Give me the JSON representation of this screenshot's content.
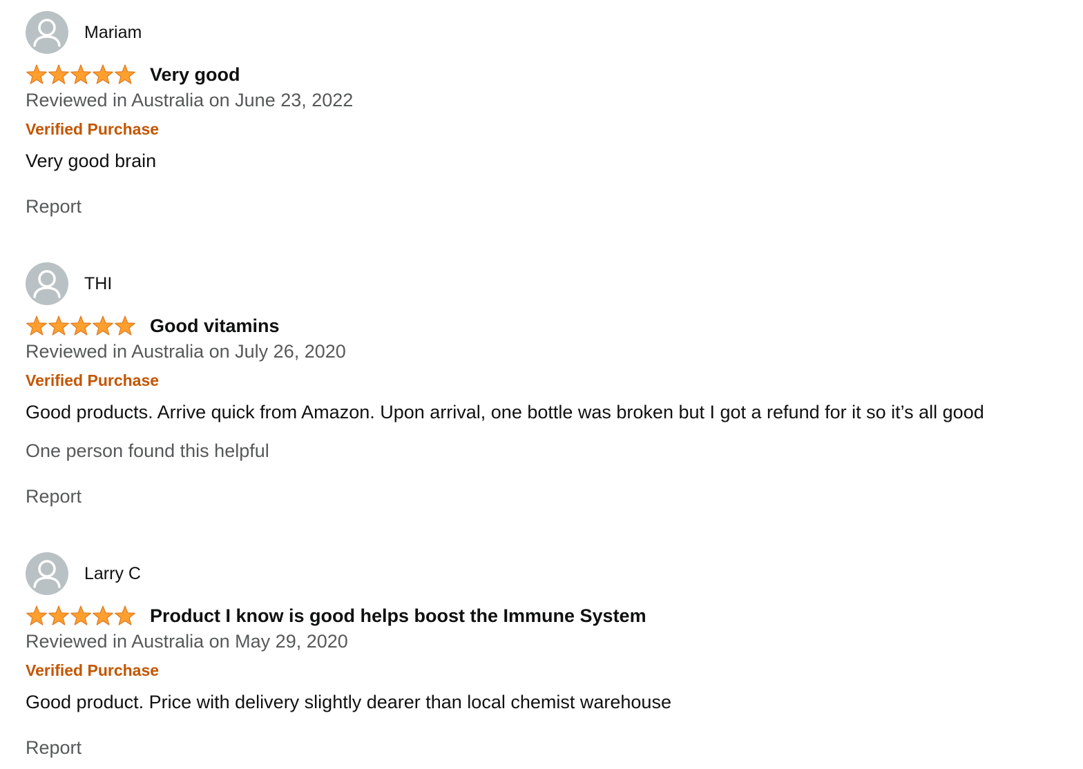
{
  "reviews": [
    {
      "reviewer_name": "Mariam",
      "avatar_icon": "user-avatar-icon",
      "rating": 5,
      "rating_max": 5,
      "title": "Very good",
      "date_line": "Reviewed in Australia on June 23, 2022",
      "verified_label": "Verified Purchase",
      "body": "Very good brain",
      "helpful_text": "",
      "report_label": "Report"
    },
    {
      "reviewer_name": "THI",
      "avatar_icon": "user-avatar-icon",
      "rating": 5,
      "rating_max": 5,
      "title": "Good vitamins",
      "date_line": "Reviewed in Australia on July 26, 2020",
      "verified_label": "Verified Purchase",
      "body": "Good products. Arrive quick from Amazon. Upon arrival, one bottle was broken but I got a refund for it so it’s all good",
      "helpful_text": "One person found this helpful",
      "report_label": "Report"
    },
    {
      "reviewer_name": "Larry C",
      "avatar_icon": "user-avatar-icon",
      "rating": 5,
      "rating_max": 5,
      "title": "Product I know is good helps boost the Immune System",
      "date_line": "Reviewed in Australia on May 29, 2020",
      "verified_label": "Verified Purchase",
      "body": "Good product. Price with delivery slightly dearer than local chemist warehouse",
      "helpful_text": "",
      "report_label": "Report"
    }
  ],
  "colors": {
    "star_fill": "#ff9f2e",
    "star_stroke": "#de7921",
    "verified": "#c45500",
    "muted_text": "#565959",
    "avatar_bg": "#bac1c4"
  }
}
